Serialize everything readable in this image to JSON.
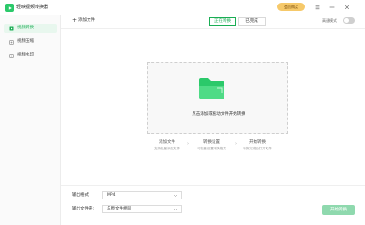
{
  "app": {
    "title": "轻映视频转换器",
    "vip_label": "会员购买",
    "accent_color": "#1aad54"
  },
  "sidebar": {
    "items": [
      {
        "label": "视频转换",
        "icon": "video-convert-icon",
        "active": true
      },
      {
        "label": "视频压缩",
        "icon": "compress-icon",
        "active": false
      },
      {
        "label": "视频水印",
        "icon": "watermark-icon",
        "active": false
      }
    ]
  },
  "toolbar": {
    "add_label": "添加文件",
    "tabs": [
      {
        "label": "正在转换",
        "active": true
      },
      {
        "label": "已完成",
        "active": false
      }
    ],
    "scan_label": "高速模式"
  },
  "dropzone": {
    "text": "点击添加或拖动文件开始转换"
  },
  "steps": [
    {
      "title": "添加文件",
      "desc": "支持批量添加文件"
    },
    {
      "title": "转换设置",
      "desc": "可批量设置转换格式"
    },
    {
      "title": "开始转换",
      "desc": "转换完成后打开文件"
    }
  ],
  "output": {
    "format_label": "输出格式:",
    "format_value": "MP4",
    "path_label": "输出文件夹:",
    "path_value": "与原文件相同"
  },
  "start_button": "开始转换"
}
